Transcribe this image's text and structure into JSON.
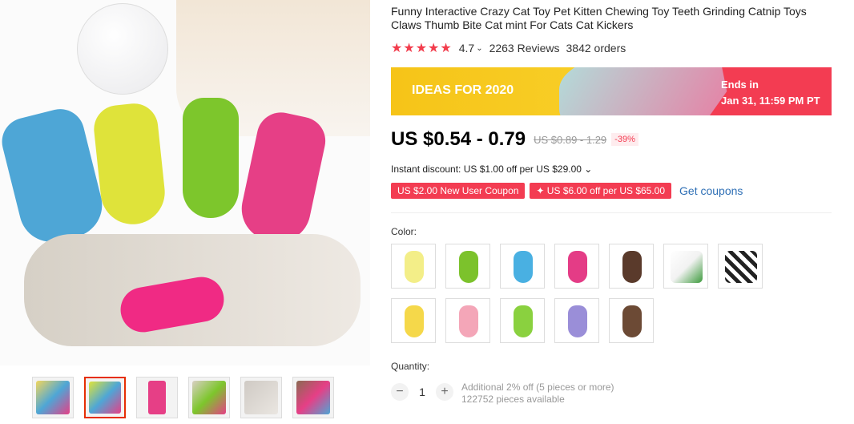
{
  "product": {
    "title": "Funny Interactive Crazy Cat Toy Pet Kitten Chewing Toy Teeth Grinding Catnip Toys Claws Thumb Bite Cat mint For Cats Cat Kickers",
    "rating_stars": "★★★★★",
    "rating": "4.7",
    "rating_caret": "⌄",
    "reviews": "2263 Reviews",
    "orders": "3842 orders"
  },
  "banner": {
    "left_text": "IDEAS FOR 2020",
    "ends_in": "Ends in",
    "end_time": "Jan 31, 11:59 PM PT"
  },
  "price": {
    "current": "US $0.54 - 0.79",
    "original": "US $0.89 - 1.29",
    "discount": "-39%"
  },
  "instant_discount": "Instant discount: US $1.00 off per US $29.00 ⌄",
  "coupons": {
    "new_user": "US $2.00 New User Coupon",
    "store": "✦ US $6.00 off per US $65.00",
    "get": "Get coupons"
  },
  "color_label": "Color:",
  "swatches": [
    {
      "name": "yellow",
      "color": "#f3ee88"
    },
    {
      "name": "green",
      "color": "#7cc22c"
    },
    {
      "name": "blue",
      "color": "#49b0e2"
    },
    {
      "name": "pink",
      "color": "#e43c86"
    },
    {
      "name": "brown",
      "color": "#5a3a2b"
    },
    {
      "name": "cat-photo",
      "color": "#e6e2dd"
    },
    {
      "name": "zebra",
      "color": "#444444"
    },
    {
      "name": "yellow-2",
      "color": "#f5d84a"
    },
    {
      "name": "light-pink",
      "color": "#f4a6b8"
    },
    {
      "name": "light-green",
      "color": "#8ad13f"
    },
    {
      "name": "purple",
      "color": "#9a8ed8"
    },
    {
      "name": "brown-2",
      "color": "#6c4a35"
    }
  ],
  "quantity_label": "Quantity:",
  "quantity": "1",
  "minus": "−",
  "plus": "+",
  "additional": "Additional 2% off (5 pieces or more)",
  "available": "122752 pieces available"
}
